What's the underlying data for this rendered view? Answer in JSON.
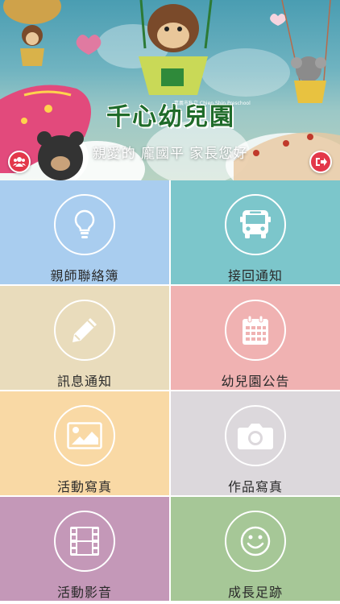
{
  "header": {
    "logo_text": "千心幼兒園",
    "logo_subtext": "嘉義市私立 Chien Shin Preschool",
    "greeting": "親愛的 龐國平 家長您好",
    "left_button_icon": "users-icon",
    "right_button_icon": "logout-icon",
    "button_color": "#e3384a"
  },
  "menu": {
    "items": [
      {
        "label": "親師聯絡簿",
        "icon": "lightbulb-icon",
        "color": "#a9cdef"
      },
      {
        "label": "接回通知",
        "icon": "bus-icon",
        "color": "#7cc6cb"
      },
      {
        "label": "訊息通知",
        "icon": "pencil-icon",
        "color": "#e9dcbc"
      },
      {
        "label": "幼兒園公告",
        "icon": "calendar-icon",
        "color": "#f0b2b2"
      },
      {
        "label": "活動寫真",
        "icon": "image-icon",
        "color": "#f9d9a5"
      },
      {
        "label": "作品寫真",
        "icon": "camera-icon",
        "color": "#dcd8dc"
      },
      {
        "label": "活動影音",
        "icon": "film-icon",
        "color": "#c498b8"
      },
      {
        "label": "成長足跡",
        "icon": "smiley-icon",
        "color": "#a6c797"
      }
    ]
  }
}
